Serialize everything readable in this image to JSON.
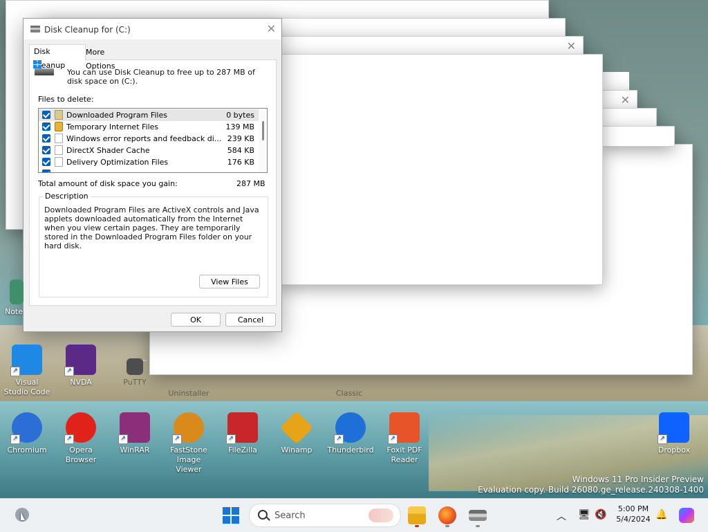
{
  "dialog": {
    "title": "Disk Cleanup for  (C:)",
    "tabs": [
      {
        "label": "Disk Cleanup",
        "active": true
      },
      {
        "label": "More Options",
        "active": false
      }
    ],
    "intro": "You can use Disk Cleanup to free up to 287 MB of disk space on  (C:).",
    "files_label": "Files to delete:",
    "files": [
      {
        "name": "Downloaded Program Files",
        "size": "0 bytes",
        "checked": true,
        "icon": "folder-icon"
      },
      {
        "name": "Temporary Internet Files",
        "size": "139 MB",
        "checked": true,
        "icon": "lock-icon"
      },
      {
        "name": "Windows error reports and feedback di...",
        "size": "239 KB",
        "checked": true,
        "icon": "file-icon"
      },
      {
        "name": "DirectX Shader Cache",
        "size": "584 KB",
        "checked": true,
        "icon": "file-icon"
      },
      {
        "name": "Delivery Optimization Files",
        "size": "176 KB",
        "checked": true,
        "icon": "file-icon"
      }
    ],
    "total_label": "Total amount of disk space you gain:",
    "total_value": "287 MB",
    "description_legend": "Description",
    "description": "Downloaded Program Files are ActiveX controls and Java applets downloaded automatically from the Internet when you view certain pages. They are temporarily stored in the Downloaded Program Files folder on your hard disk.",
    "view_files": "View Files",
    "ok": "OK",
    "cancel": "Cancel"
  },
  "desktop": {
    "icons_row1": [
      {
        "label": "Visual Studio Code",
        "color": "#1e88e5"
      },
      {
        "label": "NVDA",
        "color": "#5b2a86"
      },
      {
        "label": "PuTTY",
        "color": "#4d4d4d"
      }
    ],
    "faded_labels": [
      "Uninstaller",
      "Classic"
    ],
    "partial_label": "Note",
    "icons_row2": [
      {
        "label": "Chromium",
        "color": "#2b6fd6"
      },
      {
        "label": "Opera Browser",
        "color": "#e0221b"
      },
      {
        "label": "WinRAR",
        "color": "#8c2e7a"
      },
      {
        "label": "FastStone Image Viewer",
        "color": "#d98a1a"
      },
      {
        "label": "FileZilla",
        "color": "#c9262b"
      },
      {
        "label": "Winamp",
        "color": "#e8a418"
      },
      {
        "label": "Thunderbird",
        "color": "#1f6fd8"
      },
      {
        "label": "Foxit PDF Reader",
        "color": "#e8542a"
      }
    ],
    "dropbox": {
      "label": "Dropbox",
      "color": "#0f62fe"
    }
  },
  "watermark": {
    "line1": "Windows 11 Pro Insider Preview",
    "line2": "Evaluation copy. Build 26080.ge_release.240308-1400"
  },
  "taskbar": {
    "search_placeholder": "Search",
    "time": "5:00 PM",
    "date": "5/4/2024"
  }
}
